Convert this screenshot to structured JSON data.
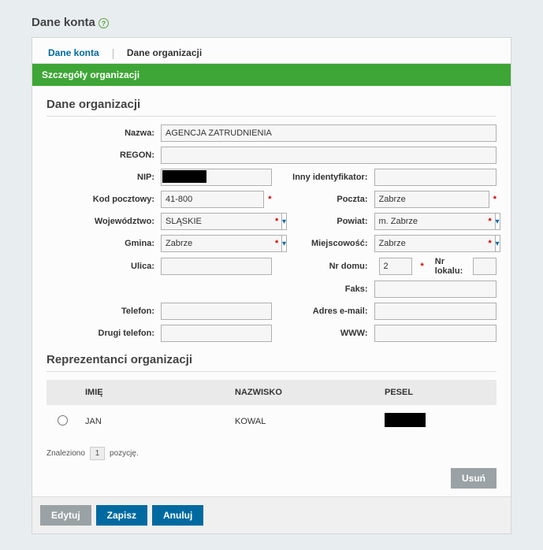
{
  "header": {
    "title": "Dane konta"
  },
  "tabs": {
    "items": [
      {
        "label": "Dane konta",
        "active": true
      },
      {
        "label": "Dane organizacji",
        "active": false
      }
    ]
  },
  "greenBar": {
    "text": "Szczegóły organizacji"
  },
  "section1": {
    "title": "Dane organizacji"
  },
  "fields": {
    "nazwa": {
      "label": "Nazwa:",
      "value": "AGENCJA ZATRUDNIENIA"
    },
    "regon": {
      "label": "REGON:",
      "value": ""
    },
    "nip": {
      "label": "NIP:",
      "value": ""
    },
    "innyId": {
      "label": "Inny identyfikator:",
      "value": ""
    },
    "kod": {
      "label": "Kod pocztowy:",
      "value": "41-800"
    },
    "poczta": {
      "label": "Poczta:",
      "value": "Zabrze"
    },
    "woj": {
      "label": "Województwo:",
      "value": "ŚLĄSKIE"
    },
    "powiat": {
      "label": "Powiat:",
      "value": "m. Zabrze"
    },
    "gmina": {
      "label": "Gmina:",
      "value": "Zabrze"
    },
    "miejsc": {
      "label": "Miejscowość:",
      "value": "Zabrze"
    },
    "ulica": {
      "label": "Ulica:",
      "value": ""
    },
    "nrdomu": {
      "label": "Nr domu:",
      "value": "2"
    },
    "nrlokalu": {
      "label": "Nr lokalu:",
      "value": ""
    },
    "faks": {
      "label": "Faks:",
      "value": ""
    },
    "telefon": {
      "label": "Telefon:",
      "value": ""
    },
    "email": {
      "label": "Adres e-mail:",
      "value": ""
    },
    "telefon2": {
      "label": "Drugi telefon:",
      "value": ""
    },
    "www": {
      "label": "WWW:",
      "value": ""
    }
  },
  "section2": {
    "title": "Reprezentanci organizacji"
  },
  "table": {
    "headers": {
      "imie": "IMIĘ",
      "nazwisko": "NAZWISKO",
      "pesel": "PESEL"
    },
    "rows": [
      {
        "imie": "JAN",
        "nazwisko": "KOWAL",
        "pesel": ""
      }
    ]
  },
  "pager": {
    "prefix": "Znaleziono",
    "count": "1",
    "suffix": "pozycję."
  },
  "buttons": {
    "usun": "Usuń",
    "edytuj": "Edytuj",
    "zapisz": "Zapisz",
    "anuluj": "Anuluj"
  },
  "required_marker": "*"
}
